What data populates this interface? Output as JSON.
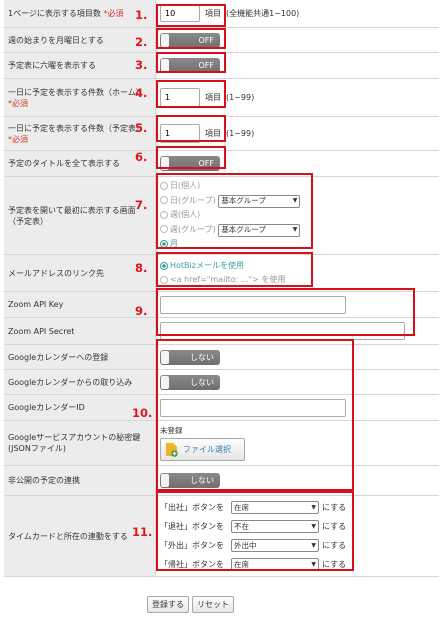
{
  "rows": {
    "items_per_page": {
      "label": "1ページに表示する項目数",
      "req": "*必須",
      "value": "10",
      "unit": "項目",
      "note": "(全機能共通1~100)"
    },
    "week_start": {
      "label": "週の始まりを月曜日とする",
      "state": "OFF"
    },
    "six_rows": {
      "label": "予定表に六曜を表示する",
      "state": "OFF"
    },
    "home_count": {
      "label": "一日に予定を表示する件数（ホーム）",
      "req": "*必須",
      "value": "1",
      "unit": "項目",
      "note": "(1~99)"
    },
    "table_count": {
      "label": "一日に予定を表示する件数（予定表）",
      "req": "*必須",
      "value": "1",
      "unit": "項目",
      "note": "(1~99)"
    },
    "full_title": {
      "label": "予定のタイトルを全て表示する",
      "state": "OFF"
    },
    "first_view": {
      "label": "予定表を開いて最初に表示する画面（予定表）",
      "options": [
        "日(個人)",
        "日(グループ)",
        "週(個人)",
        "週(グループ)",
        "月"
      ],
      "group_select_1": "基本グループ",
      "group_select_2": "基本グループ"
    },
    "mail_link": {
      "label": "メールアドレスのリンク先",
      "options": [
        "HotBizメールを使用",
        "<a href=\"mailto: ...\"> を使用"
      ]
    },
    "zoom_key": {
      "label": "Zoom API Key",
      "value": ""
    },
    "zoom_secret": {
      "label": "Zoom API Secret",
      "value": ""
    },
    "gcal_register": {
      "label": "Googleカレンダーへの登録",
      "state": "しない"
    },
    "gcal_import": {
      "label": "Googleカレンダーからの取り込み",
      "state": "しない"
    },
    "gcal_id": {
      "label": "GoogleカレンダーID",
      "value": ""
    },
    "gsa_key": {
      "label": "Googleサービスアカウントの秘密鍵(JSONファイル)",
      "status": "未登録",
      "button": "ファイル選択"
    },
    "private_link": {
      "label": "非公開の予定の連携",
      "state": "しない"
    },
    "timecard": {
      "label": "タイムカードと所在の連動をする",
      "items": [
        {
          "prefix": "「出社」ボタンを",
          "select": "在席",
          "suffix": "にする"
        },
        {
          "prefix": "「退社」ボタンを",
          "select": "不在",
          "suffix": "にする"
        },
        {
          "prefix": "「外出」ボタンを",
          "select": "外出中",
          "suffix": "にする"
        },
        {
          "prefix": "「帰社」ボタンを",
          "select": "在席",
          "suffix": "にする"
        }
      ]
    }
  },
  "numbers": [
    "1.",
    "2.",
    "3.",
    "4.",
    "5.",
    "6.",
    "7.",
    "8.",
    "9.",
    "10.",
    "11."
  ],
  "footer": {
    "submit": "登録する",
    "reset": "リセット"
  }
}
